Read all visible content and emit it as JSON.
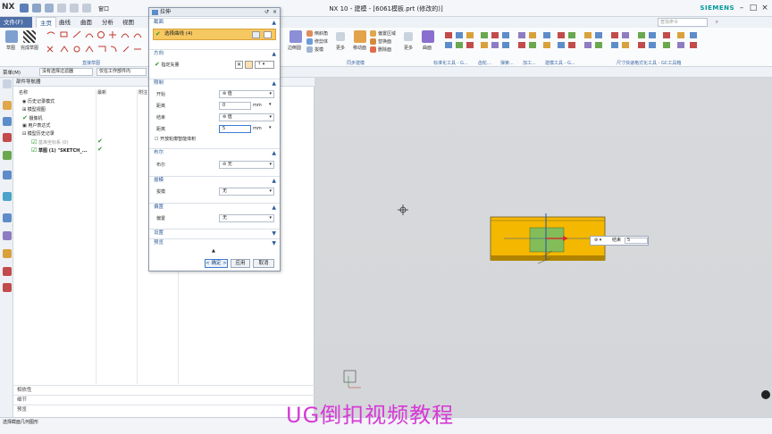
{
  "app": {
    "title": "NX 10 - 建模 - [6061模板.prt  (修改的)]",
    "brand": "SIEMENS",
    "logo": "NX",
    "window_menu": "窗口"
  },
  "menubar": {
    "file": "文件(F)",
    "tabs": [
      "主页",
      "曲线",
      "曲面",
      "分析",
      "视图"
    ],
    "search_placeholder": "查找命令"
  },
  "ribbon": {
    "sketch": "草图",
    "finish_sketch": "完成草图",
    "direct_sketch_group": "直接草图",
    "items": [
      "倒斜角",
      "修剪体",
      "拔模",
      "边倒圆",
      "更多",
      "移动面",
      "偏置区域",
      "替换面",
      "删除面",
      "更多",
      "曲面"
    ],
    "groups": [
      "同步建模",
      "标准化工具 - G...",
      "齿轮...",
      "弹簧...",
      "加工...",
      "建模工具 - G...",
      "尺寸快速格式化工具 - GC工具箱"
    ]
  },
  "selection_bar": {
    "menu": "菜单(M)",
    "filter": "没有选择过滤器",
    "scope": "仅在工作部件内"
  },
  "navigator": {
    "title": "部件导航器",
    "columns": [
      "名称",
      "最新",
      "附注"
    ],
    "items": [
      {
        "label": "历史记录模式",
        "indent": 1,
        "check": ""
      },
      {
        "label": "模型视图",
        "indent": 1,
        "check": ""
      },
      {
        "label": "摄像机",
        "indent": 1,
        "check": "✔"
      },
      {
        "label": "用户表达式",
        "indent": 1,
        "check": ""
      },
      {
        "label": "模型历史记录",
        "indent": 1,
        "check": ""
      },
      {
        "label": "基准坐标系 (0)",
        "indent": 2,
        "check": "✔"
      },
      {
        "label": "草图 (1) \"SKETCH_...",
        "indent": 2,
        "check": "✔"
      }
    ],
    "footer": [
      "相依性",
      "细节",
      "预览"
    ]
  },
  "dialog": {
    "title": "拉伸",
    "sections": {
      "section": "截面",
      "select_curve": "选择曲线 (4)",
      "direction": "方向",
      "specify_vector": "指定矢量",
      "limits": "限制",
      "start": "开始",
      "start_value": "值",
      "distance": "距离",
      "distance_start": "0",
      "unit": "mm",
      "end": "结束",
      "end_value": "值",
      "distance_end": "5",
      "open_profile": "开放轮廓智能体积",
      "boolean": "布尔",
      "boolean_label": "布尔",
      "boolean_value": "无",
      "draft": "拔模",
      "draft_label": "拔模",
      "draft_value": "无",
      "offset": "偏置",
      "offset_label": "偏置",
      "offset_value": "无",
      "settings": "设置",
      "preview": "预览"
    },
    "buttons": {
      "ok": "< 确定 >",
      "apply": "应用",
      "cancel": "取消"
    }
  },
  "viewport": {
    "end_label": "结束",
    "end_value": "5"
  },
  "status": {
    "left": "选择截面几何图形"
  },
  "watermark": "UG倒扣视频教程",
  "colors": {
    "accent": "#4f6fa8",
    "part": "#f5b800",
    "section_green": "#6fbf6a",
    "watermark": "#d639d6"
  }
}
